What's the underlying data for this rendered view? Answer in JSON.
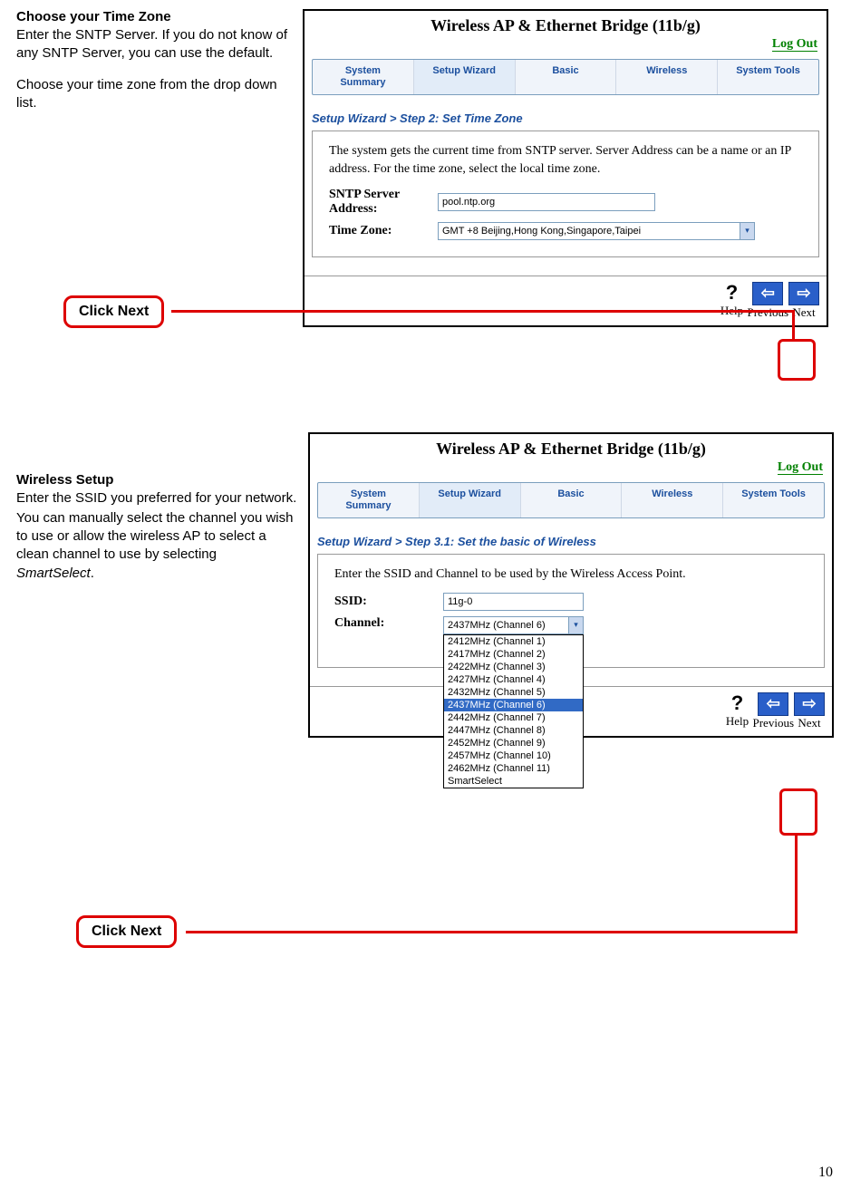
{
  "page_number": "10",
  "section1": {
    "side": {
      "heading": "Choose your Time Zone",
      "para1": "Enter the SNTP Server. If you do not know of any SNTP Server, you can use the default.",
      "para2": "Choose your time zone from the drop down list."
    },
    "callout": "Click Next",
    "panel": {
      "title": "Wireless AP & Ethernet Bridge (11b/g)",
      "logout": "Log Out",
      "tabs": {
        "t1a": "System",
        "t1b": "Summary",
        "t2": "Setup Wizard",
        "t3": "Basic",
        "t4": "Wireless",
        "t5": "System Tools"
      },
      "breadcrumb": "Setup Wizard > Step 2: Set Time Zone",
      "desc": "The system gets the current time from SNTP server. Server Address can be a name or an IP address. For the time zone, select the local time zone.",
      "sntp_label_a": "SNTP Server",
      "sntp_label_b": "Address:",
      "sntp_value": "pool.ntp.org",
      "tz_label": "Time Zone:",
      "tz_value": "GMT +8 Beijing,Hong Kong,Singapore,Taipei",
      "nav": {
        "help": "Help",
        "prev": "Previous",
        "next": "Next"
      }
    }
  },
  "section2": {
    "side": {
      "heading": "Wireless Setup",
      "para1": "Enter the SSID you preferred for your network.",
      "para2_a": "You can manually select the channel you wish to use or allow the wireless AP to select a clean channel to use by selecting ",
      "para2_b": "SmartSelect",
      "para2_c": "."
    },
    "callout": "Click Next",
    "panel": {
      "title": "Wireless AP & Ethernet Bridge (11b/g)",
      "logout": "Log Out",
      "tabs": {
        "t1a": "System",
        "t1b": "Summary",
        "t2": "Setup Wizard",
        "t3": "Basic",
        "t4": "Wireless",
        "t5": "System Tools"
      },
      "breadcrumb": "Setup Wizard > Step 3.1: Set the basic of Wireless",
      "desc": "Enter the SSID and Channel to be used by the Wireless Access Point.",
      "ssid_label": "SSID:",
      "ssid_value": "11g-0",
      "channel_label": "Channel:",
      "channel_value": "2437MHz (Channel 6)",
      "channel_options": [
        "2412MHz (Channel 1)",
        "2417MHz (Channel 2)",
        "2422MHz (Channel 3)",
        "2427MHz (Channel 4)",
        "2432MHz (Channel 5)",
        "2437MHz (Channel 6)",
        "2442MHz (Channel 7)",
        "2447MHz (Channel 8)",
        "2452MHz (Channel 9)",
        "2457MHz (Channel 10)",
        "2462MHz (Channel 11)",
        "SmartSelect"
      ],
      "nav": {
        "help": "Help",
        "prev": "Previous",
        "next": "Next"
      }
    }
  }
}
